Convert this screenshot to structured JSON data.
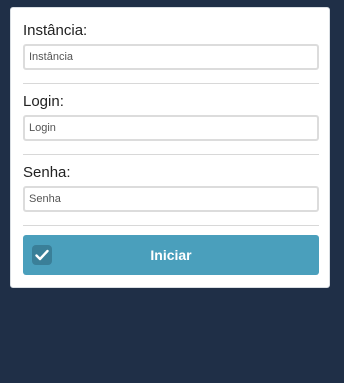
{
  "form": {
    "instancia": {
      "label": "Instância:",
      "placeholder": "Instância"
    },
    "login": {
      "label": "Login:",
      "placeholder": "Login"
    },
    "senha": {
      "label": "Senha:",
      "placeholder": "Senha"
    },
    "submit": {
      "label": "Iniciar",
      "icon": "checkmark-icon"
    }
  },
  "colors": {
    "background": "#1f2f47",
    "card": "#ffffff",
    "button": "#4a9fbc",
    "button_icon_bg": "#3a7f98"
  }
}
